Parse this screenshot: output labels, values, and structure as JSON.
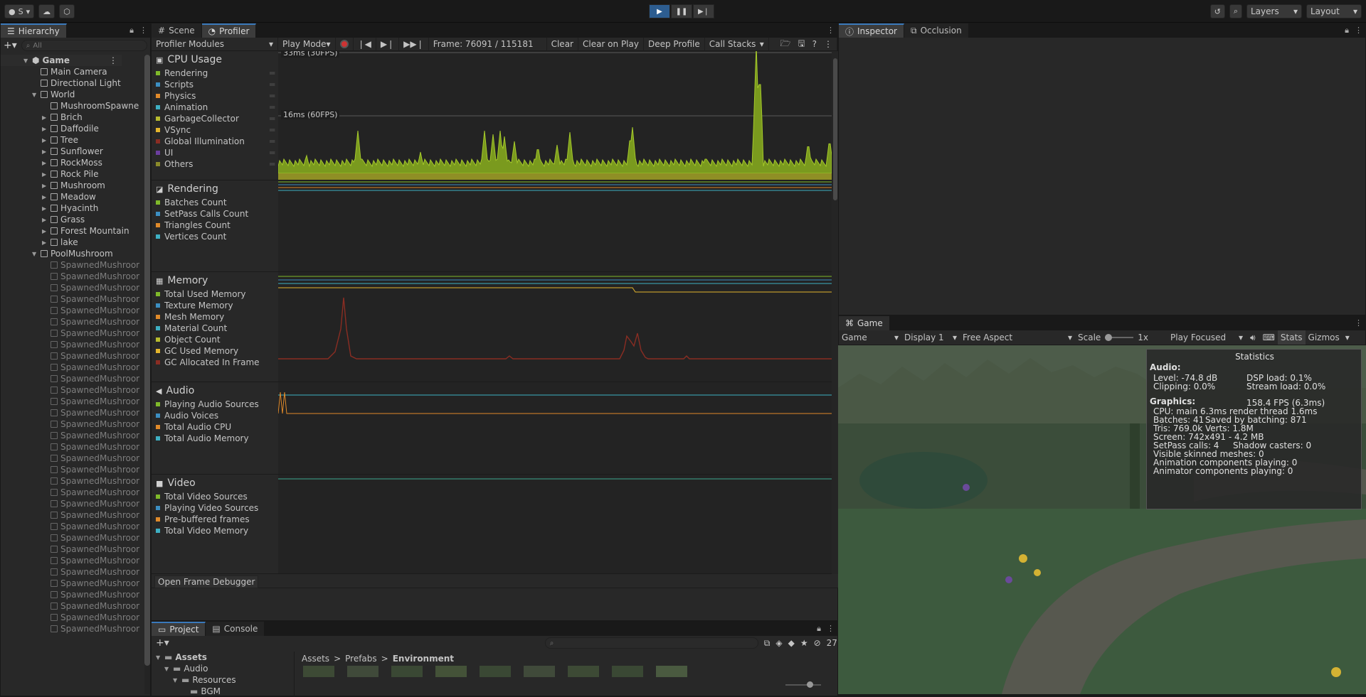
{
  "toolbar": {
    "account_label": "S",
    "layers_label": "Layers",
    "layout_label": "Layout"
  },
  "hierarchy": {
    "tab_label": "Hierarchy",
    "search_placeholder": "All",
    "scene_name": "Game",
    "items": [
      {
        "label": "Main Camera",
        "depth": 1,
        "arrow": "",
        "dim": false
      },
      {
        "label": "Directional Light",
        "depth": 1,
        "arrow": "",
        "dim": false
      },
      {
        "label": "World",
        "depth": 1,
        "arrow": "open",
        "dim": false
      },
      {
        "label": "MushroomSpawne",
        "depth": 2,
        "arrow": "",
        "dim": false
      },
      {
        "label": "Brich",
        "depth": 2,
        "arrow": "closed",
        "dim": false
      },
      {
        "label": "Daffodile",
        "depth": 2,
        "arrow": "closed",
        "dim": false
      },
      {
        "label": "Tree",
        "depth": 2,
        "arrow": "closed",
        "dim": false
      },
      {
        "label": "Sunflower",
        "depth": 2,
        "arrow": "closed",
        "dim": false
      },
      {
        "label": "RockMoss",
        "depth": 2,
        "arrow": "closed",
        "dim": false
      },
      {
        "label": "Rock Pile",
        "depth": 2,
        "arrow": "closed",
        "dim": false
      },
      {
        "label": "Mushroom",
        "depth": 2,
        "arrow": "closed",
        "dim": false
      },
      {
        "label": "Meadow",
        "depth": 2,
        "arrow": "closed",
        "dim": false
      },
      {
        "label": "Hyacinth",
        "depth": 2,
        "arrow": "closed",
        "dim": false
      },
      {
        "label": "Grass",
        "depth": 2,
        "arrow": "closed",
        "dim": false
      },
      {
        "label": "Forest Mountain",
        "depth": 2,
        "arrow": "closed",
        "dim": false
      },
      {
        "label": "lake",
        "depth": 2,
        "arrow": "closed",
        "dim": false
      },
      {
        "label": "PoolMushroom",
        "depth": 1,
        "arrow": "open",
        "dim": false
      },
      {
        "label": "SpawnedMushroor",
        "depth": 2,
        "arrow": "",
        "dim": true
      },
      {
        "label": "SpawnedMushroor",
        "depth": 2,
        "arrow": "",
        "dim": true
      },
      {
        "label": "SpawnedMushroor",
        "depth": 2,
        "arrow": "",
        "dim": true
      },
      {
        "label": "SpawnedMushroor",
        "depth": 2,
        "arrow": "",
        "dim": true
      },
      {
        "label": "SpawnedMushroor",
        "depth": 2,
        "arrow": "",
        "dim": true
      },
      {
        "label": "SpawnedMushroor",
        "depth": 2,
        "arrow": "",
        "dim": true
      },
      {
        "label": "SpawnedMushroor",
        "depth": 2,
        "arrow": "",
        "dim": true
      },
      {
        "label": "SpawnedMushroor",
        "depth": 2,
        "arrow": "",
        "dim": true
      },
      {
        "label": "SpawnedMushroor",
        "depth": 2,
        "arrow": "",
        "dim": true
      },
      {
        "label": "SpawnedMushroor",
        "depth": 2,
        "arrow": "",
        "dim": true
      },
      {
        "label": "SpawnedMushroor",
        "depth": 2,
        "arrow": "",
        "dim": true
      },
      {
        "label": "SpawnedMushroor",
        "depth": 2,
        "arrow": "",
        "dim": true
      },
      {
        "label": "SpawnedMushroor",
        "depth": 2,
        "arrow": "",
        "dim": true
      },
      {
        "label": "SpawnedMushroor",
        "depth": 2,
        "arrow": "",
        "dim": true
      },
      {
        "label": "SpawnedMushroor",
        "depth": 2,
        "arrow": "",
        "dim": true
      },
      {
        "label": "SpawnedMushroor",
        "depth": 2,
        "arrow": "",
        "dim": true
      },
      {
        "label": "SpawnedMushroor",
        "depth": 2,
        "arrow": "",
        "dim": true
      },
      {
        "label": "SpawnedMushroor",
        "depth": 2,
        "arrow": "",
        "dim": true
      },
      {
        "label": "SpawnedMushroor",
        "depth": 2,
        "arrow": "",
        "dim": true
      },
      {
        "label": "SpawnedMushroor",
        "depth": 2,
        "arrow": "",
        "dim": true
      },
      {
        "label": "SpawnedMushroor",
        "depth": 2,
        "arrow": "",
        "dim": true
      },
      {
        "label": "SpawnedMushroor",
        "depth": 2,
        "arrow": "",
        "dim": true
      },
      {
        "label": "SpawnedMushroor",
        "depth": 2,
        "arrow": "",
        "dim": true
      },
      {
        "label": "SpawnedMushroor",
        "depth": 2,
        "arrow": "",
        "dim": true
      },
      {
        "label": "SpawnedMushroor",
        "depth": 2,
        "arrow": "",
        "dim": true
      },
      {
        "label": "SpawnedMushroor",
        "depth": 2,
        "arrow": "",
        "dim": true
      },
      {
        "label": "SpawnedMushroor",
        "depth": 2,
        "arrow": "",
        "dim": true
      },
      {
        "label": "SpawnedMushroor",
        "depth": 2,
        "arrow": "",
        "dim": true
      },
      {
        "label": "SpawnedMushroor",
        "depth": 2,
        "arrow": "",
        "dim": true
      },
      {
        "label": "SpawnedMushroor",
        "depth": 2,
        "arrow": "",
        "dim": true
      },
      {
        "label": "SpawnedMushroor",
        "depth": 2,
        "arrow": "",
        "dim": true
      },
      {
        "label": "SpawnedMushroor",
        "depth": 2,
        "arrow": "",
        "dim": true
      },
      {
        "label": "SpawnedMushroor",
        "depth": 2,
        "arrow": "",
        "dim": true
      }
    ]
  },
  "center_tabs": {
    "scene": "Scene",
    "profiler": "Profiler"
  },
  "profiler": {
    "modules_label": "Profiler Modules",
    "play_mode": "Play Mode",
    "frame": "Frame: 76091 / 115181",
    "clear": "Clear",
    "clear_on_play": "Clear on Play",
    "deep_profile": "Deep Profile",
    "call_stacks": "Call Stacks",
    "label_33": "33ms (30FPS)",
    "label_16": "16ms (60FPS)",
    "open_frame_debugger": "Open Frame Debugger",
    "modules": [
      {
        "title": "CPU Usage",
        "icon": "cpu-icon",
        "series": [
          {
            "name": "Rendering",
            "color": "#7fb92a"
          },
          {
            "name": "Scripts",
            "color": "#3c8fc2"
          },
          {
            "name": "Physics",
            "color": "#e08a2a"
          },
          {
            "name": "Animation",
            "color": "#3eb0c3"
          },
          {
            "name": "GarbageCollector",
            "color": "#b7bb2e"
          },
          {
            "name": "VSync",
            "color": "#e3b52c"
          },
          {
            "name": "Global Illumination",
            "color": "#8a2d23"
          },
          {
            "name": "UI",
            "color": "#6b3d9e"
          },
          {
            "name": "Others",
            "color": "#8a8a2a"
          }
        ]
      },
      {
        "title": "Rendering",
        "icon": "rendering-icon",
        "series": [
          {
            "name": "Batches Count",
            "color": "#7fb92a"
          },
          {
            "name": "SetPass Calls Count",
            "color": "#3c8fc2"
          },
          {
            "name": "Triangles Count",
            "color": "#e08a2a"
          },
          {
            "name": "Vertices Count",
            "color": "#3eb0c3"
          }
        ]
      },
      {
        "title": "Memory",
        "icon": "memory-icon",
        "series": [
          {
            "name": "Total Used Memory",
            "color": "#7fb92a"
          },
          {
            "name": "Texture Memory",
            "color": "#3c8fc2"
          },
          {
            "name": "Mesh Memory",
            "color": "#e08a2a"
          },
          {
            "name": "Material Count",
            "color": "#3eb0c3"
          },
          {
            "name": "Object Count",
            "color": "#b7bb2e"
          },
          {
            "name": "GC Used Memory",
            "color": "#e3b52c"
          },
          {
            "name": "GC Allocated In Frame",
            "color": "#8a2d23"
          }
        ]
      },
      {
        "title": "Audio",
        "icon": "audio-icon",
        "series": [
          {
            "name": "Playing Audio Sources",
            "color": "#7fb92a"
          },
          {
            "name": "Audio Voices",
            "color": "#3c8fc2"
          },
          {
            "name": "Total Audio CPU",
            "color": "#e08a2a"
          },
          {
            "name": "Total Audio Memory",
            "color": "#3eb0c3"
          }
        ]
      },
      {
        "title": "Video",
        "icon": "video-icon",
        "series": [
          {
            "name": "Total Video Sources",
            "color": "#7fb92a"
          },
          {
            "name": "Playing Video Sources",
            "color": "#3c8fc2"
          },
          {
            "name": "Pre-buffered frames",
            "color": "#e08a2a"
          },
          {
            "name": "Total Video Memory",
            "color": "#3eb0c3"
          }
        ]
      }
    ]
  },
  "project": {
    "tab_project": "Project",
    "tab_console": "Console",
    "hidden_count": "27",
    "tree": [
      {
        "label": "Assets",
        "bold": true
      },
      {
        "label": "Audio",
        "bold": false
      },
      {
        "label": "Resources",
        "bold": false
      },
      {
        "label": "BGM",
        "bold": false
      }
    ],
    "breadcrumb": [
      "Assets",
      "Prefabs",
      "Environment"
    ]
  },
  "inspector": {
    "tab_inspector": "Inspector",
    "tab_occlusion": "Occlusion"
  },
  "game": {
    "tab_label": "Game",
    "view_dd": "Game",
    "display_dd": "Display 1",
    "aspect_dd": "Free Aspect",
    "scale_label": "Scale",
    "scale_value": "1x",
    "play_focused": "Play Focused",
    "stats_label": "Stats",
    "gizmos_label": "Gizmos",
    "statistics": {
      "title": "Statistics",
      "audio_heading": "Audio:",
      "level": "Level: -74.8 dB",
      "dsp": "DSP load: 0.1%",
      "clipping": "Clipping: 0.0%",
      "stream": "Stream load: 0.0%",
      "graphics_heading": "Graphics:",
      "fps": "158.4 FPS (6.3ms)",
      "cpu": "CPU: main 6.3ms  render thread 1.6ms",
      "batches": "Batches: 41",
      "saved": "Saved by batching: 871",
      "tris": "Tris: 769.0k",
      "verts": "Verts: 1.8M",
      "screen": "Screen: 742x491 - 4.2 MB",
      "setpass": "SetPass calls: 4",
      "shadow": "Shadow casters: 0",
      "skinned": "Visible skinned meshes: 0",
      "anim": "Animation components playing: 0",
      "animator": "Animator components playing: 0"
    }
  }
}
